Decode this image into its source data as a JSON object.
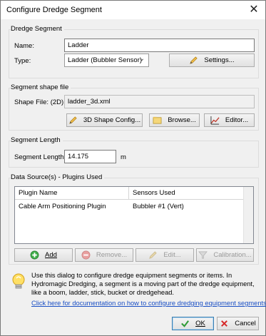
{
  "window": {
    "title": "Configure Dredge Segment"
  },
  "dredge_segment": {
    "group_label": "Dredge Segment",
    "name_label": "Name:",
    "name_value": "Ladder",
    "type_label": "Type:",
    "type_value": "Ladder (Bubbler Sensor)",
    "settings_label": "Settings..."
  },
  "shape_file": {
    "group_label": "Segment shape file",
    "label": "Shape File: (2D):",
    "value": "ladder_3d.xml",
    "shape_config_label": "3D Shape Config...",
    "browse_label": "Browse...",
    "editor_label": "Editor..."
  },
  "segment_length": {
    "group_label": "Segment Length",
    "label": "Segment Length:",
    "value": "14.175",
    "unit": "m"
  },
  "data_sources": {
    "group_label": "Data Source(s) - Plugins Used",
    "columns": [
      "Plugin Name",
      "Sensors Used"
    ],
    "rows": [
      {
        "plugin": "Cable Arm Positioning Plugin",
        "sensors": "Bubbler #1 (Vert)"
      }
    ],
    "add_label": "Add",
    "remove_label": "Remove...",
    "edit_label": "Edit...",
    "calibration_label": "Calibration..."
  },
  "info": {
    "text": "Use this dialog to configure dredge equipment segments or items. In Hydromagic Dredging, a segment is a moving part of the dredge equipment, like a boom, ladder, stick, bucket or dredgehead.",
    "link": "Click here for documentation on how to configure dredging equipment segments."
  },
  "footer": {
    "ok_label": "OK",
    "cancel_label": "Cancel"
  },
  "colors": {
    "link": "#1a4fc4",
    "ok_border": "#3c7fb1"
  }
}
